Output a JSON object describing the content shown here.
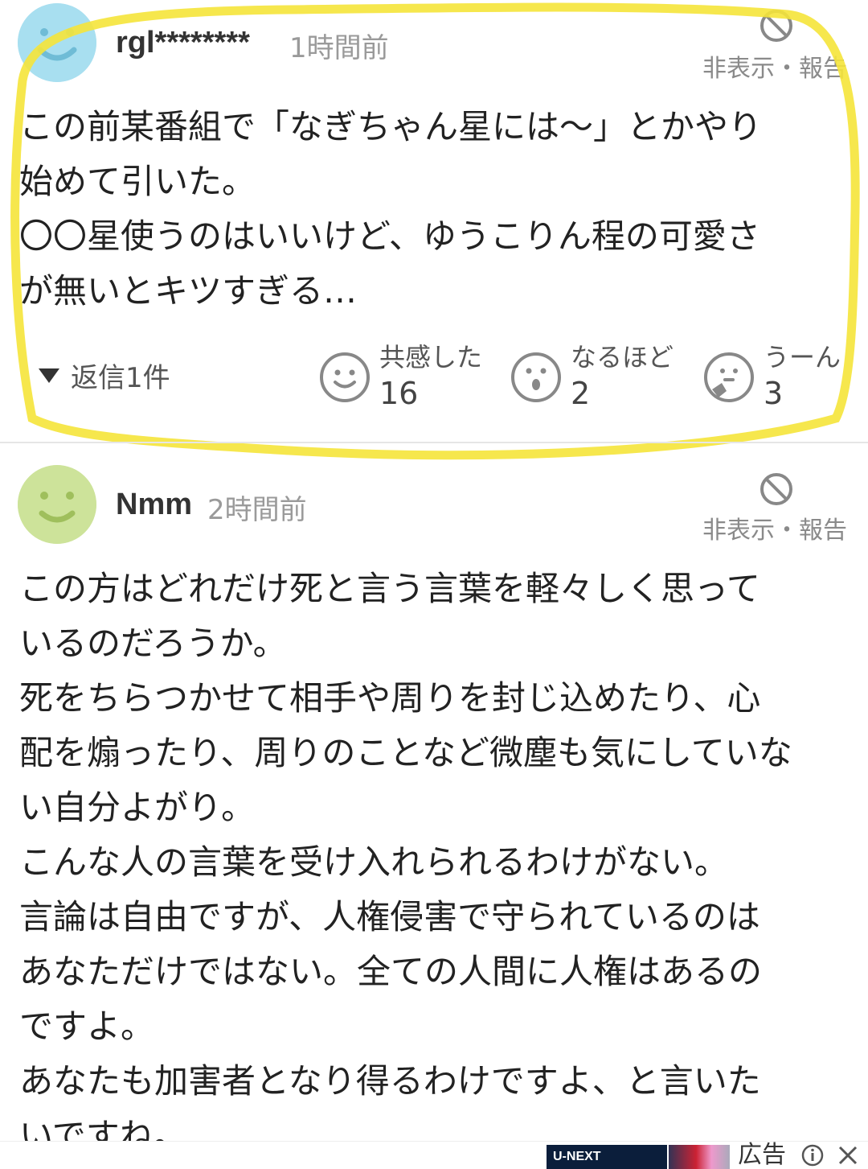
{
  "comments": [
    {
      "user": "rgl********",
      "time": "1時間前",
      "actions": "非表示・報告",
      "body": "この前某番組で「なぎちゃん星には〜」とかやり\n始めて引いた。\n〇〇星使うのはいいけど、ゆうこりん程の可愛さ\nが無いとキツすぎる…",
      "reply_toggle": "返信1件",
      "reactions": [
        {
          "label": "共感した",
          "count": "16",
          "icon": "smile-face-icon"
        },
        {
          "label": "なるほど",
          "count": "2",
          "icon": "surprised-face-icon"
        },
        {
          "label": "うーん",
          "count": "3",
          "icon": "thinking-face-icon"
        }
      ],
      "avatar_color": "#a8dff0"
    },
    {
      "user": "Nmm",
      "time": "2時間前",
      "actions": "非表示・報告",
      "body": "この方はどれだけ死と言う言葉を軽々しく思って\nいるのだろうか。\n死をちらつかせて相手や周りを封じ込めたり、心\n配を煽ったり、周りのことなど微塵も気にしていな\nい自分よがり。\nこんな人の言葉を受け入れられるわけがない。\n言論は自由ですが、人権侵害で守られているのは\nあなただけではない。全ての人間に人権はあるの\nですよ。\nあなたも加害者となり得るわけですよ、と言いた\nいですね。",
      "avatar_color": "#cde39a"
    }
  ],
  "ad": {
    "brand": "U-NEXT",
    "label": "広告"
  },
  "colors": {
    "highlight": "#f5e43a",
    "muted_text": "#8a8a8a"
  }
}
